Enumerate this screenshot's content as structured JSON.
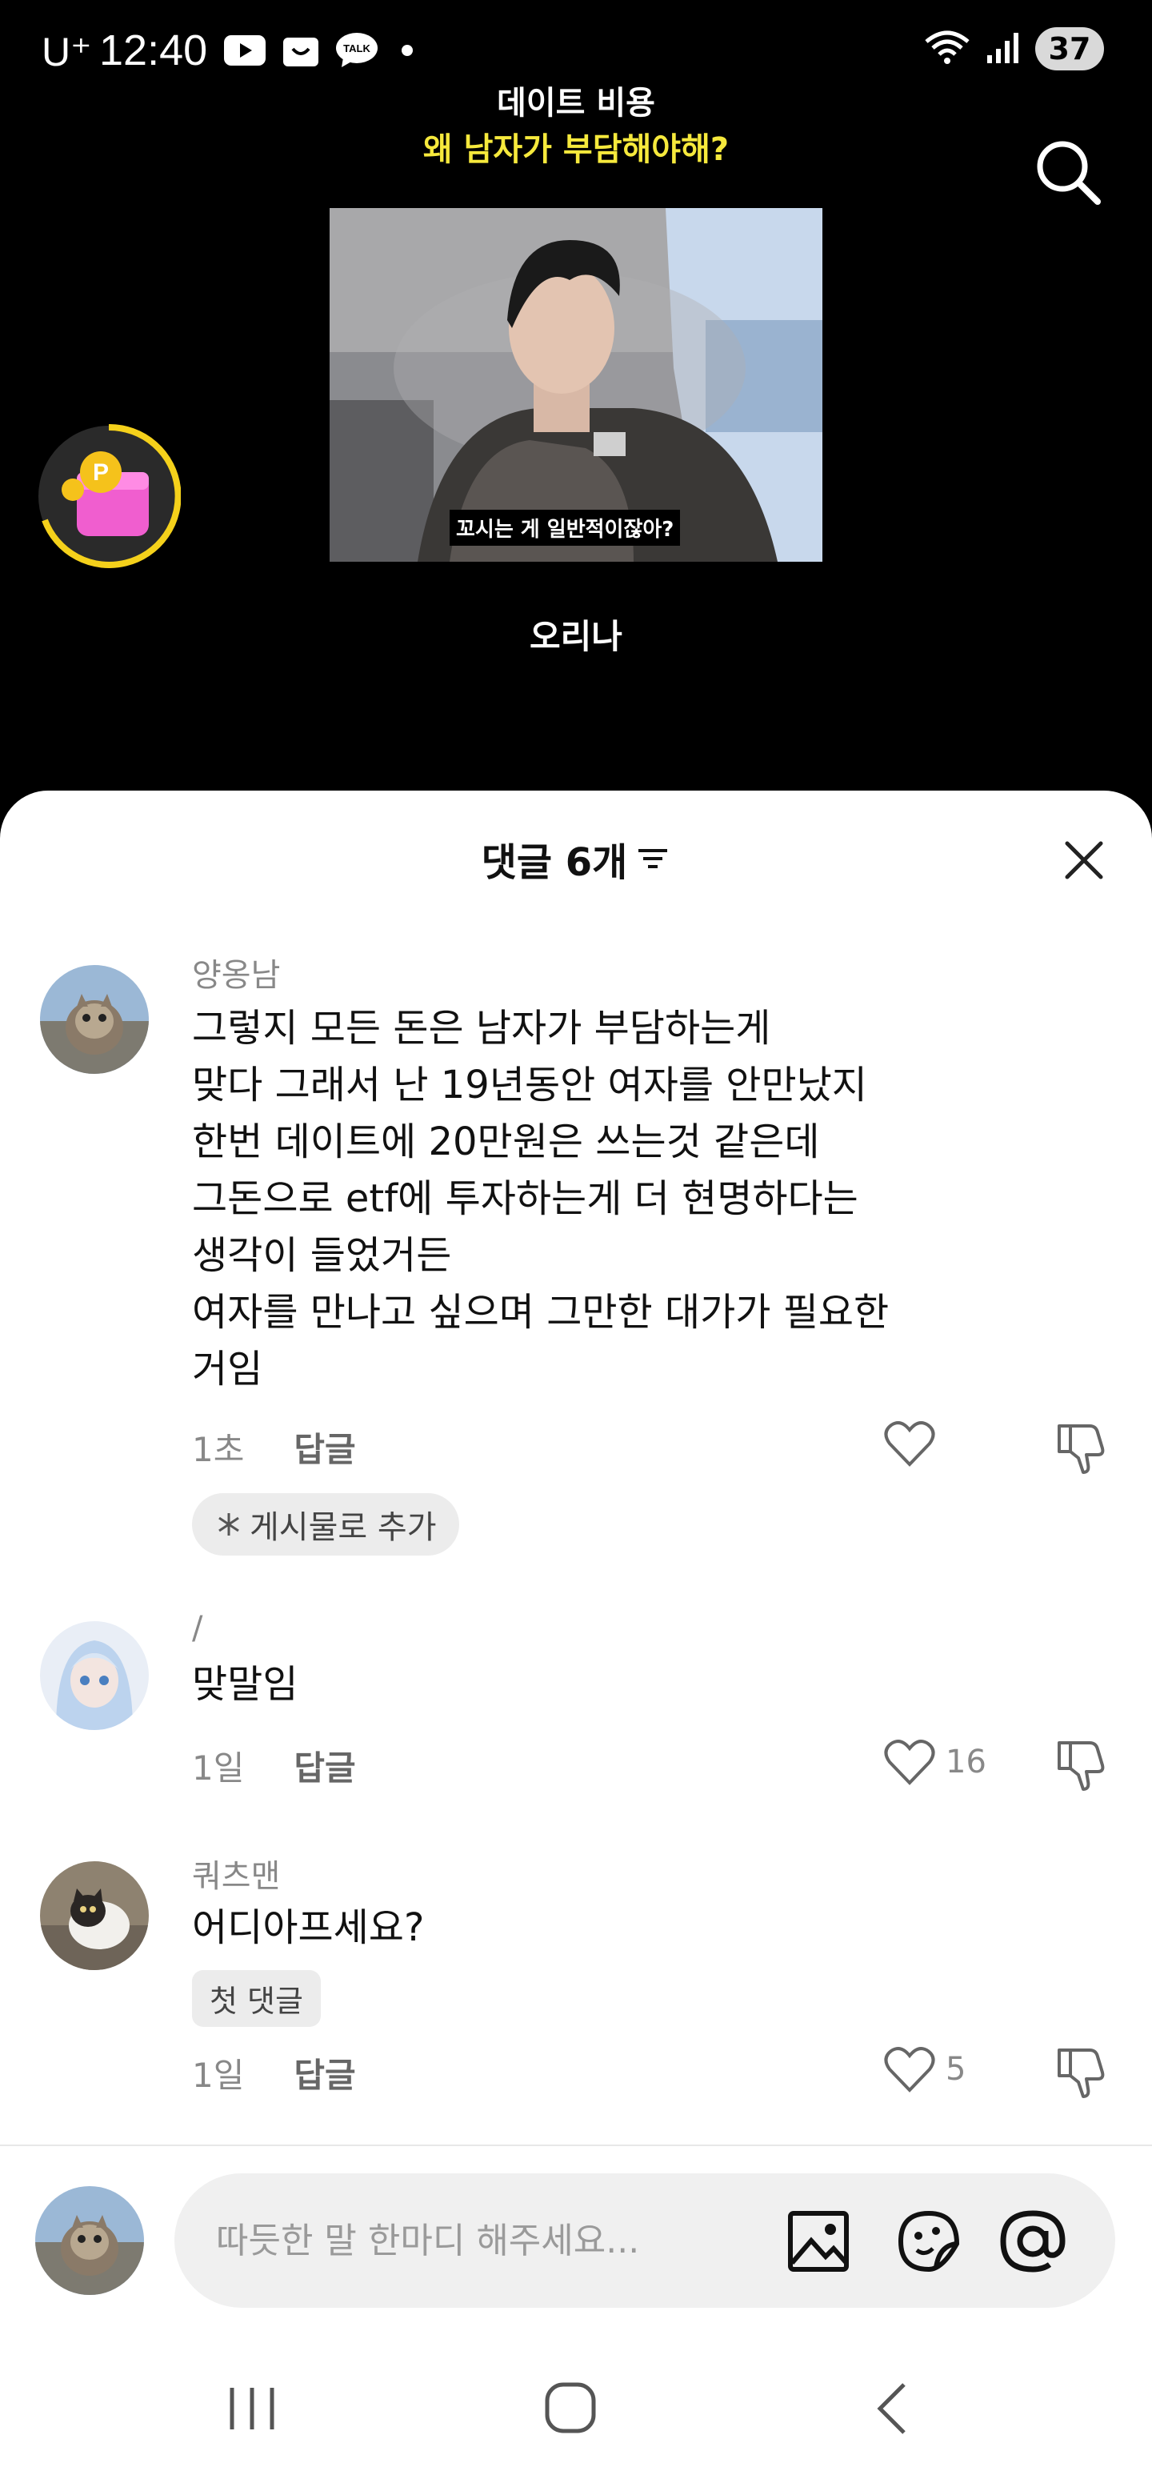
{
  "status_bar": {
    "carrier": "U⁺",
    "time": "12:40",
    "battery": "37",
    "icons": [
      "youtube-icon",
      "shopping-icon",
      "talk-icon",
      "notification-dot-icon",
      "wifi-icon",
      "signal-icon"
    ]
  },
  "video": {
    "title_line1": "데이트 비용",
    "title_line2": "왜 남자가 부담해야해?",
    "caption": "꼬시는 게 일반적이잖아?",
    "author": "오리나"
  },
  "comments_sheet": {
    "title": "댓글 6개",
    "comments": [
      {
        "user": "양옹남",
        "text": "그렇지 모든 돈은 남자가 부담하는게\n맞다 그래서 난 19년동안 여자를 안만났지\n한번 데이트에 20만원은 쓰는것 같은데\n그돈으로 etf에 투자하는게 더 현명하다는\n생각이 들었거든\n여자를 만나고 싶으며 그만한 대가가 필요한\n거임",
        "time": "1초",
        "reply": "답글",
        "likes": "",
        "chip": "게시물로 추가"
      },
      {
        "user": "/",
        "text": "맞말임",
        "time": "1일",
        "reply": "답글",
        "likes": "16"
      },
      {
        "user": "쿼츠맨",
        "text": "어디아프세요?",
        "badge": "첫 댓글",
        "time": "1일",
        "reply": "답글",
        "likes": "5"
      }
    ]
  },
  "input": {
    "placeholder": "따듯한 말 한마디 해주세요..."
  },
  "colors": {
    "title_yellow": "#f6e93c",
    "background_dark": "#000000",
    "sheet_bg": "#ffffff"
  }
}
